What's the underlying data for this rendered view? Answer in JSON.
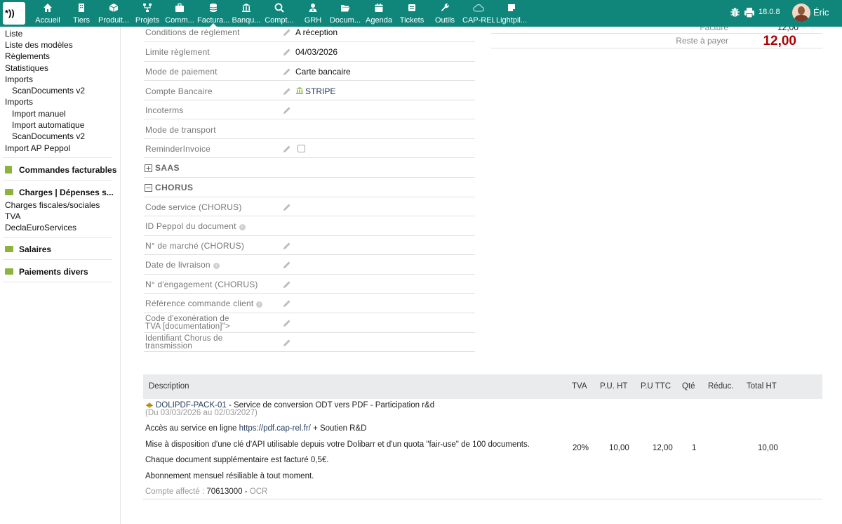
{
  "topbar": {
    "logo_text": "*))",
    "menu": [
      {
        "label": "Accueil",
        "icon": "home-icon"
      },
      {
        "label": "Tiers",
        "icon": "building-icon"
      },
      {
        "label": "Produit...",
        "icon": "cube-icon"
      },
      {
        "label": "Projets",
        "icon": "sitemap-icon"
      },
      {
        "label": "Comm...",
        "icon": "briefcase-icon"
      },
      {
        "label": "Factura...",
        "icon": "coins-icon"
      },
      {
        "label": "Banqu...",
        "icon": "bank-icon"
      },
      {
        "label": "Compt...",
        "icon": "search-dollar-icon"
      },
      {
        "label": "GRH",
        "icon": "user-tie-icon"
      },
      {
        "label": "Docum...",
        "icon": "folder-open-icon"
      },
      {
        "label": "Agenda",
        "icon": "calendar-icon"
      },
      {
        "label": "Tickets",
        "icon": "ticket-icon"
      },
      {
        "label": "Outils",
        "icon": "wrench-icon"
      },
      {
        "label": "CAP-REL",
        "icon": "cloud-icon"
      },
      {
        "label": "Lightpil...",
        "icon": "note-icon"
      }
    ],
    "version": "18.0.8",
    "username": "Éric",
    "bar_color": "#10867b"
  },
  "leftmenu": {
    "links_top": [
      {
        "label": "Liste"
      },
      {
        "label": "Liste des modèles"
      },
      {
        "label": "Règlements"
      },
      {
        "label": "Statistiques"
      },
      {
        "label": "Imports"
      },
      {
        "label": "ScanDocuments v2"
      },
      {
        "label": "Imports"
      },
      {
        "label": "Import manuel"
      },
      {
        "label": "Import automatique"
      },
      {
        "label": "ScanDocuments v2"
      },
      {
        "label": "Import AP Peppol"
      }
    ],
    "section_commandes": "Commandes facturables",
    "section_charges": "Charges | Dépenses s...",
    "charges_links": [
      "Charges fiscales/sociales",
      "TVA",
      "DeclaEuroServices"
    ],
    "section_salaires": "Salaires",
    "section_paiements": "Paiements divers"
  },
  "fields": {
    "conditions_label": "Conditions de règlement",
    "conditions_value": "A réception",
    "limite_label": "Limite règlement",
    "limite_value": "04/03/2026",
    "mode_paiement_label": "Mode de paiement",
    "mode_paiement_value": "Carte bancaire",
    "compte_label": "Compte Bancaire",
    "compte_value": "STRIPE",
    "incoterms_label": "Incoterms",
    "transport_label": "Mode de transport",
    "reminder_label": "ReminderInvoice",
    "saas_title": "SAAS",
    "chorus_title": "CHORUS",
    "code_service_label": "Code service (CHORUS)",
    "id_peppol_label": "ID Peppol du document",
    "marche_label": "N° de marché (CHORUS)",
    "livraison_label": "Date de livraison",
    "engagement_label": "N° d'engagement (CHORUS)",
    "ref_commande_label": "Référence commande client",
    "exoneration_label_1": "Code d'exonération de",
    "exoneration_label_2": "TVA [documentation]\">",
    "chorus_transmission_label_1": "Identifiant Chorus de",
    "chorus_transmission_label_2": "transmission"
  },
  "totals": {
    "facture_label": "Facturé",
    "facture_value": "12,00",
    "reste_label": "Reste à payer",
    "reste_value": "12,00"
  },
  "lines_table": {
    "headers": {
      "description": "Description",
      "tva": "TVA",
      "pu_ht": "P.U. HT",
      "pu_ttc": "P.U TTC",
      "qte": "Qté",
      "reduc": "Réduc.",
      "total_ht": "Total HT"
    },
    "line1": {
      "product_ref": "DOLIPDF-PACK-01",
      "product_desc": " - Service de conversion ODT vers PDF - Participation r&d",
      "period": "(Du 03/03/2026 au 02/03/2027)",
      "desc_line1_prefix": "Accès au service en ligne ",
      "desc_line1_link": "https://pdf.cap-rel.fr/",
      "desc_line1_suffix": " + Soutien R&D",
      "desc_line2": "Mise à disposition d'une clé d'API utilisable depuis votre Dolibarr et d'un quota \"fair-use\" de 100 documents.",
      "desc_line3": "Chaque document supplémentaire est facturé 0,5€.",
      "desc_line4": "Abonnement mensuel résiliable à tout moment.",
      "compte_label": "Compte affecté : ",
      "compte_value": "70613000",
      "compte_sep": " - ",
      "compte_ocr": "OCR",
      "tva": "20%",
      "pu_ht": "10,00",
      "pu_ttc": "12,00",
      "qte": "1",
      "total_ht": "10,00"
    }
  }
}
